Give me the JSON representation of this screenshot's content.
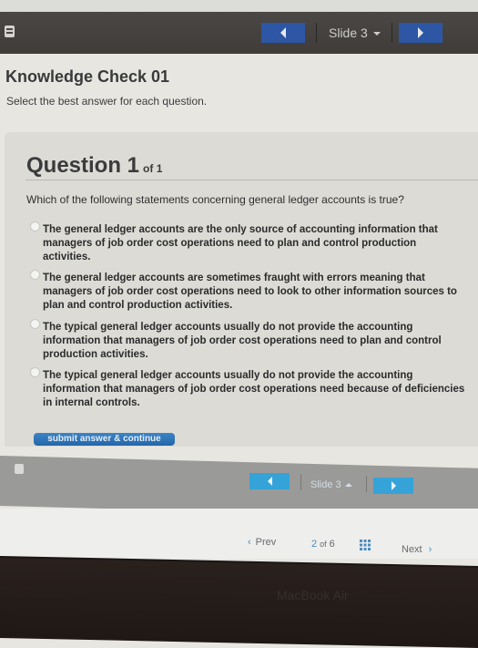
{
  "top_nav": {
    "book_icon": "book-icon",
    "prev_icon": "triangle-left-icon",
    "slide_label": "Slide 3",
    "dropdown_icon": "caret-down-icon",
    "next_icon": "triangle-right-icon",
    "button_color": "#2d56a4"
  },
  "header": {
    "title": "Knowledge Check 01",
    "subtitle": "Select the best answer for each question."
  },
  "question": {
    "title": "Question 1",
    "of_label": "of 1",
    "prompt": "Which of the following statements concerning general ledger accounts is true?",
    "options": [
      {
        "label": "The general ledger accounts are the only source of accounting information that managers of job order cost operations need to plan and control production activities.",
        "selected": false
      },
      {
        "label": "The general ledger accounts are sometimes fraught with errors meaning that managers of job order cost operations need to look to other information sources to plan and control production activities.",
        "selected": false
      },
      {
        "label": "The typical general ledger accounts usually do not provide the accounting information that managers of job order cost operations need to plan and control production activities.",
        "selected": false
      },
      {
        "label": "The typical general ledger accounts usually do not provide the accounting information that managers of job order cost operations need because of deficiencies in internal controls.",
        "selected": false
      }
    ],
    "submit_label": "submit answer & continue"
  },
  "bottom_nav": {
    "slide_label": "Slide 3",
    "button_color": "#35a3d8"
  },
  "pager": {
    "prev_label": "Prev",
    "prev_icon": "chevron-left-icon",
    "current": "2",
    "of_label": "of",
    "total": "6",
    "grid_icon": "grid-icon",
    "next_label": "Next",
    "next_icon": "chevron-right-icon"
  },
  "device": {
    "label": "MacBook Air"
  }
}
